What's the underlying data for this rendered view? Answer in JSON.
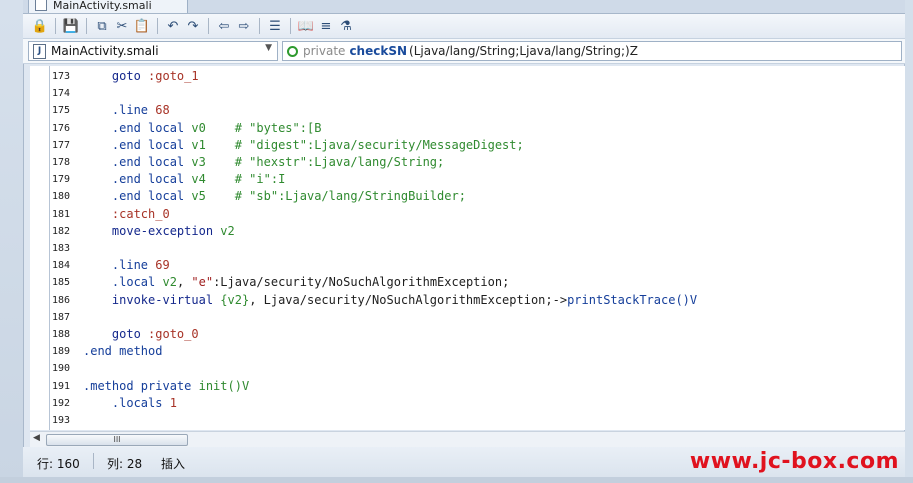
{
  "window": {
    "tab_title": "MainActivity.smali"
  },
  "toolbar": {
    "icons": [
      "lock-icon",
      "save-icon",
      "copy-icon",
      "cut-icon",
      "paste-icon",
      "undo-icon",
      "redo-icon",
      "back-icon",
      "forward-icon",
      "format-icon",
      "book-icon",
      "list-icon",
      "debug-icon"
    ]
  },
  "nav": {
    "file": "MainActivity.smali",
    "method_modifier": "private",
    "method_name": "checkSN",
    "method_signature": "(Ljava/lang/String;Ljava/lang/String;)Z"
  },
  "code_lines": [
    {
      "n": "173",
      "code": [
        {
          "t": "    goto ",
          "c": "c-kw"
        },
        {
          "t": ":goto_1",
          "c": "c-lbl"
        }
      ]
    },
    {
      "n": "174",
      "code": []
    },
    {
      "n": "175",
      "code": [
        {
          "t": "    .line ",
          "c": "c-dir"
        },
        {
          "t": "68",
          "c": "c-num"
        }
      ]
    },
    {
      "n": "176",
      "code": [
        {
          "t": "    .end local ",
          "c": "c-dir"
        },
        {
          "t": "v0",
          "c": "c-reg"
        },
        {
          "t": "    # \"bytes\":[B",
          "c": "c-cmt"
        }
      ]
    },
    {
      "n": "177",
      "code": [
        {
          "t": "    .end local ",
          "c": "c-dir"
        },
        {
          "t": "v1",
          "c": "c-reg"
        },
        {
          "t": "    # \"digest\":Ljava/security/MessageDigest;",
          "c": "c-cmt"
        }
      ]
    },
    {
      "n": "178",
      "code": [
        {
          "t": "    .end local ",
          "c": "c-dir"
        },
        {
          "t": "v3",
          "c": "c-reg"
        },
        {
          "t": "    # \"hexstr\":Ljava/lang/String;",
          "c": "c-cmt"
        }
      ]
    },
    {
      "n": "179",
      "code": [
        {
          "t": "    .end local ",
          "c": "c-dir"
        },
        {
          "t": "v4",
          "c": "c-reg"
        },
        {
          "t": "    # \"i\":I",
          "c": "c-cmt"
        }
      ]
    },
    {
      "n": "180",
      "code": [
        {
          "t": "    .end local ",
          "c": "c-dir"
        },
        {
          "t": "v5",
          "c": "c-reg"
        },
        {
          "t": "    # \"sb\":Ljava/lang/StringBuilder;",
          "c": "c-cmt"
        }
      ]
    },
    {
      "n": "181",
      "code": [
        {
          "t": "    :catch_0",
          "c": "c-lbl"
        }
      ]
    },
    {
      "n": "182",
      "code": [
        {
          "t": "    move-exception ",
          "c": "c-kw"
        },
        {
          "t": "v2",
          "c": "c-reg"
        }
      ]
    },
    {
      "n": "183",
      "code": []
    },
    {
      "n": "184",
      "code": [
        {
          "t": "    .line ",
          "c": "c-dir"
        },
        {
          "t": "69",
          "c": "c-num"
        }
      ]
    },
    {
      "n": "185",
      "code": [
        {
          "t": "    .local ",
          "c": "c-dir"
        },
        {
          "t": "v2",
          "c": "c-reg"
        },
        {
          "t": ", ",
          "c": "c-punc"
        },
        {
          "t": "\"e\"",
          "c": "c-str"
        },
        {
          "t": ":Ljava/security/NoSuchAlgorithmException;",
          "c": "c-cls"
        }
      ]
    },
    {
      "n": "186",
      "code": [
        {
          "t": "    invoke-virtual ",
          "c": "c-kw"
        },
        {
          "t": "{v2}",
          "c": "c-reg"
        },
        {
          "t": ", Ljava/security/NoSuchAlgorithmException;->",
          "c": "c-cls"
        },
        {
          "t": "printStackTrace()V",
          "c": "c-dir"
        }
      ]
    },
    {
      "n": "187",
      "code": []
    },
    {
      "n": "188",
      "code": [
        {
          "t": "    goto ",
          "c": "c-kw"
        },
        {
          "t": ":goto_0",
          "c": "c-lbl"
        }
      ]
    },
    {
      "n": "189",
      "code": [
        {
          "t": ".end method",
          "c": "c-dir"
        }
      ]
    },
    {
      "n": "190",
      "code": []
    },
    {
      "n": "191",
      "code": [
        {
          "t": ".method private ",
          "c": "c-dir"
        },
        {
          "t": "init()V",
          "c": "c-reg"
        }
      ]
    },
    {
      "n": "192",
      "code": [
        {
          "t": "    .locals ",
          "c": "c-dir"
        },
        {
          "t": "1",
          "c": "c-num"
        }
      ]
    },
    {
      "n": "193",
      "code": []
    }
  ],
  "scrollbar": {
    "thumb_grip": "III"
  },
  "status": {
    "row": "行: 160",
    "col": "列: 28",
    "mode": "插入",
    "watermark": "www.jc-box.com"
  }
}
